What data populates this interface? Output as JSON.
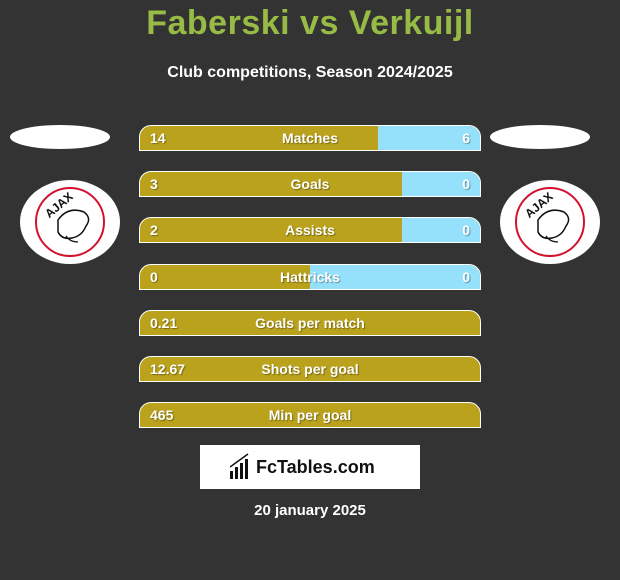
{
  "header": {
    "title": "Faberski vs Verkuijl",
    "subtitle": "Club competitions, Season 2024/2025"
  },
  "players": {
    "left": {
      "club_logo": "ajax-logo"
    },
    "right": {
      "club_logo": "ajax-logo"
    }
  },
  "colors": {
    "left_bar": "#baa21c",
    "right_bar": "#95e1fb",
    "title": "#98bb45",
    "background": "#333333"
  },
  "stats": [
    {
      "label": "Matches",
      "left": "14",
      "right": "6",
      "left_share": 0.7
    },
    {
      "label": "Goals",
      "left": "3",
      "right": "0",
      "left_share": 0.77
    },
    {
      "label": "Assists",
      "left": "2",
      "right": "0",
      "left_share": 0.77
    },
    {
      "label": "Hattricks",
      "left": "0",
      "right": "0",
      "left_share": 0.5
    },
    {
      "label": "Goals per match",
      "left": "0.21",
      "right": null,
      "left_share": 1
    },
    {
      "label": "Shots per goal",
      "left": "12.67",
      "right": null,
      "left_share": 1
    },
    {
      "label": "Min per goal",
      "left": "465",
      "right": null,
      "left_share": 1
    }
  ],
  "footer": {
    "brand": "FcTables.com",
    "date": "20 january 2025"
  }
}
